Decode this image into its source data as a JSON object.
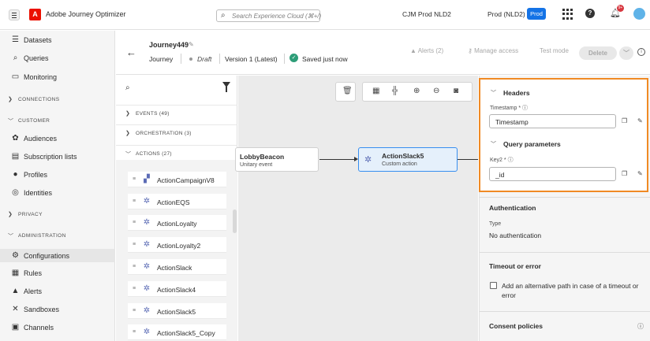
{
  "topbar": {
    "app_title": "Adobe Journey Optimizer",
    "logo_glyph": "A",
    "search_placeholder": "Search Experience Cloud (⌘+/)",
    "org": "CJM Prod NLD2",
    "sandbox": "Prod (NLD2)",
    "sandbox_badge": "Prod",
    "notification_count": "9+"
  },
  "leftnav": {
    "items": [
      {
        "label": "Datasets",
        "icon": "database-icon"
      },
      {
        "label": "Queries",
        "icon": "queries-icon"
      },
      {
        "label": "Monitoring",
        "icon": "monitoring-icon"
      },
      {
        "label": "CONNECTIONS",
        "section": true,
        "expanded": false
      },
      {
        "label": "CUSTOMER",
        "section": true,
        "expanded": true
      },
      {
        "label": "Audiences",
        "icon": "audiences-icon"
      },
      {
        "label": "Subscription lists",
        "icon": "subscription-icon"
      },
      {
        "label": "Profiles",
        "icon": "profile-icon"
      },
      {
        "label": "Identities",
        "icon": "identity-icon"
      },
      {
        "label": "PRIVACY",
        "section": true,
        "expanded": false
      },
      {
        "label": "ADMINISTRATION",
        "section": true,
        "expanded": true
      },
      {
        "label": "Configurations",
        "icon": "configurations-icon",
        "active": true
      },
      {
        "label": "Rules",
        "icon": "rules-icon"
      },
      {
        "label": "Alerts",
        "icon": "alert-icon"
      },
      {
        "label": "Sandboxes",
        "icon": "sandboxes-icon"
      },
      {
        "label": "Channels",
        "icon": "channels-icon"
      }
    ]
  },
  "journey": {
    "name": "Journey449",
    "type": "Journey",
    "status": "Draft",
    "version": "Version 1 (Latest)",
    "saved": "Saved just now",
    "buttons": {
      "alerts": "Alerts (2)",
      "manage_access": "Manage access",
      "test_mode": "Test mode",
      "delete": "Delete"
    }
  },
  "palette": {
    "categories": [
      {
        "label": "EVENTS (49)",
        "expanded": false
      },
      {
        "label": "ORCHESTRATION (3)",
        "expanded": false
      },
      {
        "label": "ACTIONS (27)",
        "expanded": true
      }
    ],
    "actions": [
      "ActionCampaignV8",
      "ActionEQS",
      "ActionLoyalty",
      "ActionLoyalty2",
      "ActionSlack",
      "ActionSlack4",
      "ActionSlack5",
      "ActionSlack5_Copy"
    ]
  },
  "canvas": {
    "nodes": [
      {
        "title": "LobbyBeacon",
        "subtitle": "Unitary event"
      },
      {
        "title": "ActionSlack5",
        "subtitle": "Custom action",
        "selected": true
      }
    ]
  },
  "panel": {
    "headers": {
      "title": "Headers",
      "field_label": "Timestamp",
      "field_value": "Timestamp"
    },
    "query": {
      "title": "Query parameters",
      "field_label": "Key2",
      "field_value": "_id"
    },
    "required_mark": "*",
    "authentication": {
      "title": "Authentication",
      "type_label": "Type",
      "type_value": "No authentication"
    },
    "timeout": {
      "title": "Timeout or error",
      "checkbox_label": "Add an alternative path in case of a timeout or error",
      "checked": false
    },
    "consent": {
      "title": "Consent policies"
    }
  },
  "colors": {
    "accent": "#1473e6",
    "highlight": "#f08a24",
    "adobe_red": "#eb1000",
    "saved_green": "#2d9d78"
  }
}
